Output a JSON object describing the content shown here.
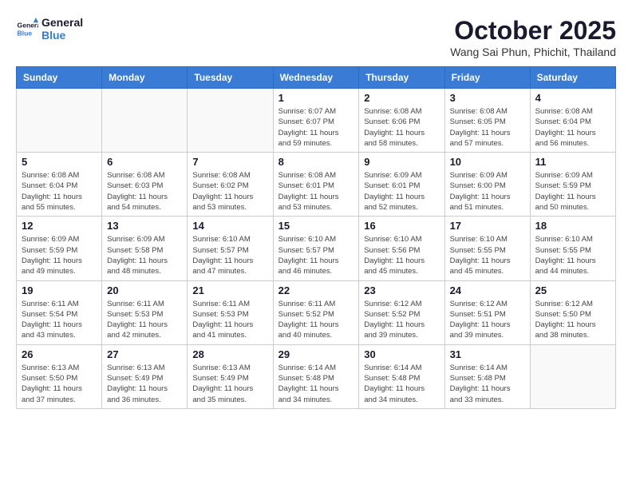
{
  "logo": {
    "line1": "General",
    "line2": "Blue"
  },
  "title": "October 2025",
  "location": "Wang Sai Phun, Phichit, Thailand",
  "weekdays": [
    "Sunday",
    "Monday",
    "Tuesday",
    "Wednesday",
    "Thursday",
    "Friday",
    "Saturday"
  ],
  "weeks": [
    [
      {
        "day": "",
        "detail": ""
      },
      {
        "day": "",
        "detail": ""
      },
      {
        "day": "",
        "detail": ""
      },
      {
        "day": "1",
        "detail": "Sunrise: 6:07 AM\nSunset: 6:07 PM\nDaylight: 11 hours\nand 59 minutes."
      },
      {
        "day": "2",
        "detail": "Sunrise: 6:08 AM\nSunset: 6:06 PM\nDaylight: 11 hours\nand 58 minutes."
      },
      {
        "day": "3",
        "detail": "Sunrise: 6:08 AM\nSunset: 6:05 PM\nDaylight: 11 hours\nand 57 minutes."
      },
      {
        "day": "4",
        "detail": "Sunrise: 6:08 AM\nSunset: 6:04 PM\nDaylight: 11 hours\nand 56 minutes."
      }
    ],
    [
      {
        "day": "5",
        "detail": "Sunrise: 6:08 AM\nSunset: 6:04 PM\nDaylight: 11 hours\nand 55 minutes."
      },
      {
        "day": "6",
        "detail": "Sunrise: 6:08 AM\nSunset: 6:03 PM\nDaylight: 11 hours\nand 54 minutes."
      },
      {
        "day": "7",
        "detail": "Sunrise: 6:08 AM\nSunset: 6:02 PM\nDaylight: 11 hours\nand 53 minutes."
      },
      {
        "day": "8",
        "detail": "Sunrise: 6:08 AM\nSunset: 6:01 PM\nDaylight: 11 hours\nand 53 minutes."
      },
      {
        "day": "9",
        "detail": "Sunrise: 6:09 AM\nSunset: 6:01 PM\nDaylight: 11 hours\nand 52 minutes."
      },
      {
        "day": "10",
        "detail": "Sunrise: 6:09 AM\nSunset: 6:00 PM\nDaylight: 11 hours\nand 51 minutes."
      },
      {
        "day": "11",
        "detail": "Sunrise: 6:09 AM\nSunset: 5:59 PM\nDaylight: 11 hours\nand 50 minutes."
      }
    ],
    [
      {
        "day": "12",
        "detail": "Sunrise: 6:09 AM\nSunset: 5:59 PM\nDaylight: 11 hours\nand 49 minutes."
      },
      {
        "day": "13",
        "detail": "Sunrise: 6:09 AM\nSunset: 5:58 PM\nDaylight: 11 hours\nand 48 minutes."
      },
      {
        "day": "14",
        "detail": "Sunrise: 6:10 AM\nSunset: 5:57 PM\nDaylight: 11 hours\nand 47 minutes."
      },
      {
        "day": "15",
        "detail": "Sunrise: 6:10 AM\nSunset: 5:57 PM\nDaylight: 11 hours\nand 46 minutes."
      },
      {
        "day": "16",
        "detail": "Sunrise: 6:10 AM\nSunset: 5:56 PM\nDaylight: 11 hours\nand 45 minutes."
      },
      {
        "day": "17",
        "detail": "Sunrise: 6:10 AM\nSunset: 5:55 PM\nDaylight: 11 hours\nand 45 minutes."
      },
      {
        "day": "18",
        "detail": "Sunrise: 6:10 AM\nSunset: 5:55 PM\nDaylight: 11 hours\nand 44 minutes."
      }
    ],
    [
      {
        "day": "19",
        "detail": "Sunrise: 6:11 AM\nSunset: 5:54 PM\nDaylight: 11 hours\nand 43 minutes."
      },
      {
        "day": "20",
        "detail": "Sunrise: 6:11 AM\nSunset: 5:53 PM\nDaylight: 11 hours\nand 42 minutes."
      },
      {
        "day": "21",
        "detail": "Sunrise: 6:11 AM\nSunset: 5:53 PM\nDaylight: 11 hours\nand 41 minutes."
      },
      {
        "day": "22",
        "detail": "Sunrise: 6:11 AM\nSunset: 5:52 PM\nDaylight: 11 hours\nand 40 minutes."
      },
      {
        "day": "23",
        "detail": "Sunrise: 6:12 AM\nSunset: 5:52 PM\nDaylight: 11 hours\nand 39 minutes."
      },
      {
        "day": "24",
        "detail": "Sunrise: 6:12 AM\nSunset: 5:51 PM\nDaylight: 11 hours\nand 39 minutes."
      },
      {
        "day": "25",
        "detail": "Sunrise: 6:12 AM\nSunset: 5:50 PM\nDaylight: 11 hours\nand 38 minutes."
      }
    ],
    [
      {
        "day": "26",
        "detail": "Sunrise: 6:13 AM\nSunset: 5:50 PM\nDaylight: 11 hours\nand 37 minutes."
      },
      {
        "day": "27",
        "detail": "Sunrise: 6:13 AM\nSunset: 5:49 PM\nDaylight: 11 hours\nand 36 minutes."
      },
      {
        "day": "28",
        "detail": "Sunrise: 6:13 AM\nSunset: 5:49 PM\nDaylight: 11 hours\nand 35 minutes."
      },
      {
        "day": "29",
        "detail": "Sunrise: 6:14 AM\nSunset: 5:48 PM\nDaylight: 11 hours\nand 34 minutes."
      },
      {
        "day": "30",
        "detail": "Sunrise: 6:14 AM\nSunset: 5:48 PM\nDaylight: 11 hours\nand 34 minutes."
      },
      {
        "day": "31",
        "detail": "Sunrise: 6:14 AM\nSunset: 5:48 PM\nDaylight: 11 hours\nand 33 minutes."
      },
      {
        "day": "",
        "detail": ""
      }
    ]
  ]
}
